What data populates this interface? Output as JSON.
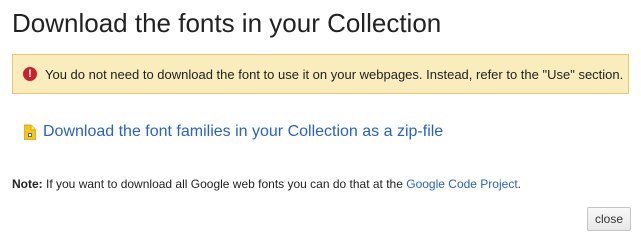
{
  "dialog": {
    "title": "Download the fonts in your Collection",
    "warning": {
      "icon": "exclamation-circle-icon",
      "text": "You do not need to download the font to use it on your webpages. Instead, refer to the \"Use\" section."
    },
    "download_link": {
      "icon": "zip-file-icon",
      "label": "Download the font families in your Collection as a zip-file"
    },
    "note": {
      "label": "Note:",
      "text": " If you want to download all Google web fonts you can do that at the ",
      "link": "Google Code Project",
      "suffix": "."
    },
    "close_label": "close"
  },
  "colors": {
    "warning_bg": "#f9edbe",
    "warning_border": "#f0c36d",
    "link": "#2a62c4",
    "warning_icon": "#c8232c"
  }
}
